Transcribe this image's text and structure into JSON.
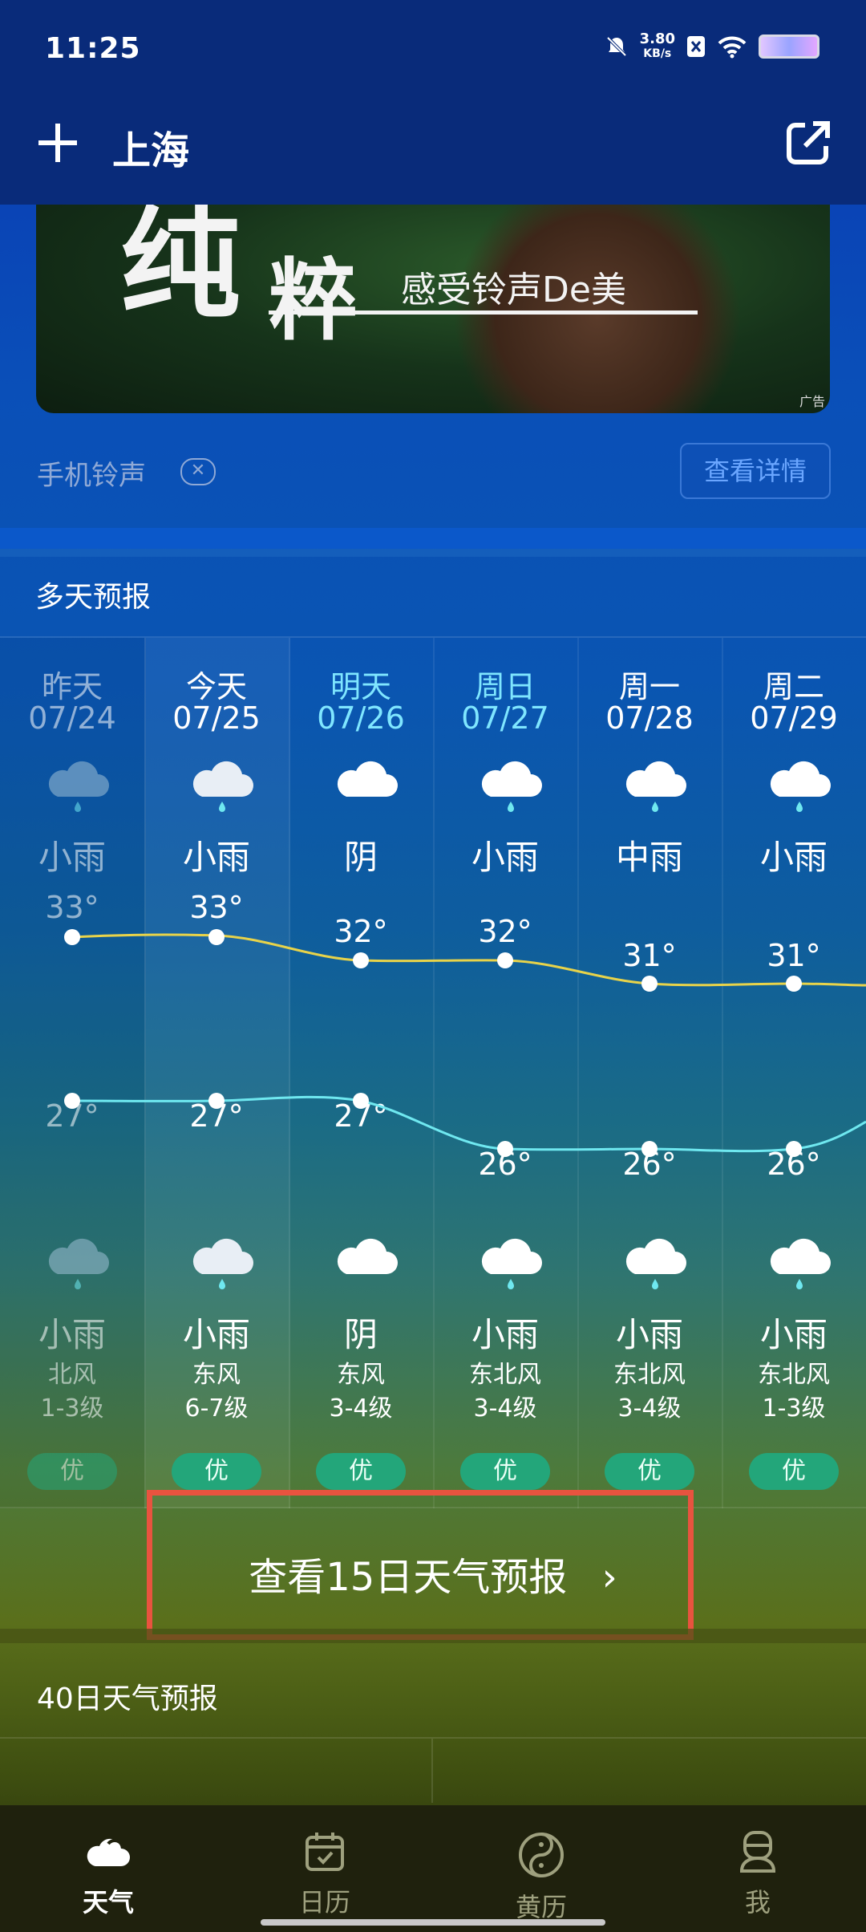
{
  "status": {
    "time": "11:25",
    "speed_value": "3.80",
    "speed_unit": "KB/s"
  },
  "header": {
    "city": "上海"
  },
  "ad": {
    "big_char1": "纯",
    "big_char2": "粹",
    "slogan": "感受铃声De美",
    "tag": "广告",
    "label": "手机铃声",
    "close": "✕",
    "details_button": "查看详情"
  },
  "forecast": {
    "title": "多天预报",
    "days": [
      {
        "day": "昨天",
        "date": "07/24",
        "cond_day": "小雨",
        "high": "33°",
        "low": "27°",
        "cond_night": "小雨",
        "wind_dir": "北风",
        "wind_lv": "1-3级",
        "aqi": "优"
      },
      {
        "day": "今天",
        "date": "07/25",
        "cond_day": "小雨",
        "high": "33°",
        "low": "27°",
        "cond_night": "小雨",
        "wind_dir": "东风",
        "wind_lv": "6-7级",
        "aqi": "优"
      },
      {
        "day": "明天",
        "date": "07/26",
        "cond_day": "阴",
        "high": "32°",
        "low": "27°",
        "cond_night": "阴",
        "wind_dir": "东风",
        "wind_lv": "3-4级",
        "aqi": "优"
      },
      {
        "day": "周日",
        "date": "07/27",
        "cond_day": "小雨",
        "high": "32°",
        "low": "26°",
        "cond_night": "小雨",
        "wind_dir": "东北风",
        "wind_lv": "3-4级",
        "aqi": "优"
      },
      {
        "day": "周一",
        "date": "07/28",
        "cond_day": "中雨",
        "high": "31°",
        "low": "26°",
        "cond_night": "小雨",
        "wind_dir": "东北风",
        "wind_lv": "3-4级",
        "aqi": "优"
      },
      {
        "day": "周二",
        "date": "07/29",
        "cond_day": "小雨",
        "high": "31°",
        "low": "26°",
        "cond_night": "小雨",
        "wind_dir": "东北风",
        "wind_lv": "1-3级",
        "aqi": "优"
      }
    ],
    "more_button": "查看15日天气预报",
    "more_chevron": "›"
  },
  "forecast40": {
    "title": "40日天气预报"
  },
  "nav": {
    "items": [
      "天气",
      "日历",
      "黄历",
      "我"
    ]
  },
  "colors": {
    "high_line": "#e8d34a",
    "low_line": "#6fe8f0",
    "highlight": "#e8533f",
    "aqi_bg": "#23a67a",
    "accent_day": "#7fe6ff"
  }
}
